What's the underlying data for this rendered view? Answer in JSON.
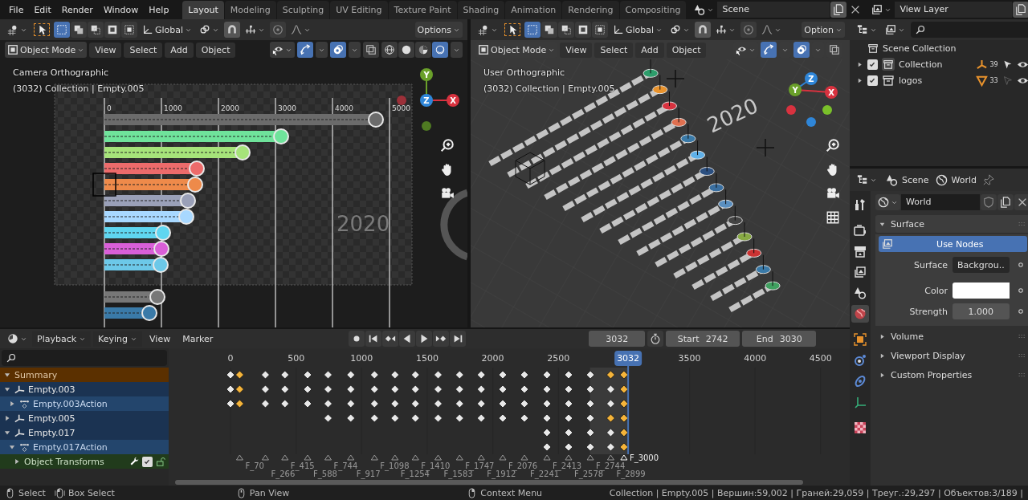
{
  "menu_bar": {
    "menus": [
      "File",
      "Edit",
      "Render",
      "Window",
      "Help"
    ],
    "workspaces": [
      {
        "label": "Layout",
        "selected": true
      },
      {
        "label": "Modeling",
        "selected": false
      },
      {
        "label": "Sculpting",
        "selected": false
      },
      {
        "label": "UV Editing",
        "selected": false
      },
      {
        "label": "Texture Paint",
        "selected": false
      },
      {
        "label": "Shading",
        "selected": false
      },
      {
        "label": "Animation",
        "selected": false
      },
      {
        "label": "Rendering",
        "selected": false
      },
      {
        "label": "Compositing",
        "selected": false
      }
    ],
    "scene": "Scene",
    "view_layer": "View Layer"
  },
  "viewports": [
    {
      "kind": "camera",
      "orientation": "Global",
      "options": "Options",
      "mode": "Object Mode",
      "menus": [
        "View",
        "Select",
        "Add",
        "Object"
      ],
      "view_name": "Camera Orthographic",
      "context": "(3032) Collection | Empty.005",
      "axes": [
        "Y",
        "Z",
        "X"
      ],
      "scene_labels": [
        "0",
        "1000",
        "2000",
        "3000",
        "4000",
        "5000"
      ],
      "year": "2020"
    },
    {
      "kind": "user",
      "orientation": "Global",
      "options": "Option",
      "mode": "Object Mode",
      "menus": [
        "View",
        "Select",
        "Add",
        "Object"
      ],
      "view_name": "User Orthographic",
      "context": "(3032) Collection | Empty.005",
      "axes": [
        "Z",
        "Y",
        "X"
      ],
      "year": "2020"
    }
  ],
  "outliner": {
    "root": "Scene Collection",
    "items": [
      {
        "name": "Collection",
        "checked": true,
        "kind": "empties",
        "count": "39",
        "selectable": true
      },
      {
        "name": "logos",
        "checked": true,
        "kind": "cones",
        "count": "33",
        "selectable": false
      }
    ]
  },
  "properties": {
    "tabs": [
      "Scene",
      "World"
    ],
    "datablock": "World",
    "side_tabs": [
      {
        "kind": "tool",
        "selected": false
      },
      {
        "kind": "render",
        "selected": false
      },
      {
        "kind": "output",
        "selected": false
      },
      {
        "kind": "view_layer",
        "selected": false
      },
      {
        "kind": "scene",
        "selected": false
      },
      {
        "kind": "world",
        "selected": true
      },
      {
        "kind": "object",
        "selected": false
      },
      {
        "kind": "physics",
        "selected": false
      },
      {
        "kind": "constraints",
        "selected": false
      },
      {
        "kind": "data",
        "selected": false
      },
      {
        "kind": "texture",
        "selected": false
      }
    ],
    "panels": [
      {
        "title": "Surface",
        "expanded": true,
        "button": "Use Nodes",
        "fields": [
          {
            "kind": "menu",
            "label": "Surface",
            "value": "Backgrou.."
          },
          {
            "kind": "color",
            "label": "Color",
            "color": "#ffffff"
          },
          {
            "kind": "number",
            "label": "Strength",
            "value": "1.000"
          }
        ]
      },
      {
        "title": "Volume",
        "expanded": false
      },
      {
        "title": "Viewport Display",
        "expanded": false
      },
      {
        "title": "Custom Properties",
        "expanded": false
      }
    ]
  },
  "timeline": {
    "menus": [
      {
        "label": "Playback",
        "dropdown": true
      },
      {
        "label": "Keying",
        "dropdown": true
      },
      {
        "label": "View",
        "dropdown": false
      },
      {
        "label": "Marker",
        "dropdown": false
      }
    ],
    "current_frame": "3032",
    "start_label": "Start",
    "start": "2742",
    "end_label": "End",
    "end": "3030",
    "ruler": [
      "0",
      "500",
      "1000",
      "1500",
      "2000",
      "2500",
      "3500",
      "4000",
      "4500"
    ],
    "playhead": "3032",
    "channels": [
      {
        "kind": "summary",
        "name": "Summary",
        "expanded": true
      },
      {
        "kind": "object",
        "name": "Empty.003",
        "expanded": true
      },
      {
        "kind": "action",
        "name": "Empty.003Action",
        "expanded": false
      },
      {
        "kind": "object",
        "name": "Empty.005",
        "expanded": false
      },
      {
        "kind": "object",
        "name": "Empty.017",
        "expanded": true
      },
      {
        "kind": "action",
        "name": "Empty.017Action",
        "expanded": true
      },
      {
        "kind": "group",
        "name": "Object Transforms",
        "expanded": false,
        "checked": true
      }
    ],
    "markers": [
      {
        "label": "F_3000",
        "selected": true
      },
      {
        "label": "F_70",
        "selected": false
      },
      {
        "label": "F_266",
        "selected": false
      },
      {
        "label": "F_415",
        "selected": false
      },
      {
        "label": "F_588",
        "selected": false
      },
      {
        "label": "F_744",
        "selected": false
      },
      {
        "label": "F_917",
        "selected": false
      },
      {
        "label": "F_1098",
        "selected": false
      },
      {
        "label": "F_1254",
        "selected": false
      },
      {
        "label": "F_1410",
        "selected": false
      },
      {
        "label": "F_1583",
        "selected": false
      },
      {
        "label": "F_1747",
        "selected": false
      },
      {
        "label": "F_1912",
        "selected": false
      },
      {
        "label": "F_2076",
        "selected": false
      },
      {
        "label": "F_2241",
        "selected": false
      },
      {
        "label": "F_2413",
        "selected": false
      },
      {
        "label": "F_2578",
        "selected": false
      },
      {
        "label": "F_2744",
        "selected": false
      },
      {
        "label": "F_2899",
        "selected": false
      }
    ]
  },
  "status_bar": {
    "hints": [
      {
        "kind": "left",
        "label": "Select"
      },
      {
        "kind": "drag",
        "label": "Box Select"
      },
      {
        "kind": "middle",
        "label": "Pan View"
      },
      {
        "kind": "right",
        "label": "Context Menu"
      }
    ],
    "stats": "Collection | Empty.005 | Вершин:59,002 | Граней:29,059 | Треуг.:29,297 | Объектов:3/189 |"
  }
}
